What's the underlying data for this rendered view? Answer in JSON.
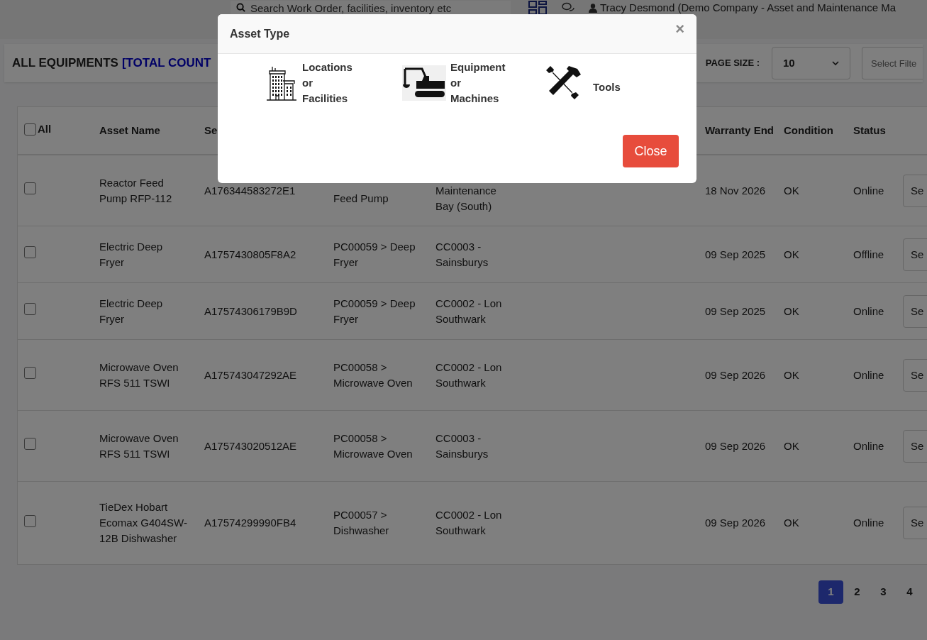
{
  "top_bar": {
    "search": {
      "placeholder": "Search Work Order, facilities, inventory etc"
    },
    "user": "Tracy Desmond (Demo Company - Asset and Maintenance Ma"
  },
  "header": {
    "title": "ALL EQUIPMENTS",
    "count_label": "[TOTAL COUNT",
    "page_size_label": "PAGE SIZE :",
    "page_size": "10",
    "filter": {
      "placeholder": "Select Filte"
    }
  },
  "table": {
    "columns": [
      {
        "label": "All",
        "checked": false
      },
      {
        "label": "Asset Name"
      },
      {
        "label": "Se"
      },
      {},
      {},
      {},
      {
        "label": "Warranty End"
      },
      {
        "label": "Condition"
      },
      {
        "label": "Status"
      }
    ],
    "rows": [
      {
        "checked": false,
        "asset_name": "Reactor Feed Pump RFP-112",
        "serial": "A176344583272E1",
        "column_3": "Feed Pump",
        "column_4": "Maintenance Bay (South)",
        "warranty_end": "18 Nov 2026",
        "condition": "OK",
        "status": "Online",
        "action": "Se"
      },
      {
        "checked": false,
        "asset_name": "Electric Deep Fryer",
        "serial": "A1757430805F8A2",
        "column_3": "PC00059 > Deep Fryer",
        "column_4": "CC0003 - Sainsburys",
        "warranty_end": "09 Sep 2025",
        "condition": "OK",
        "status": "Offline",
        "action": "Se"
      },
      {
        "checked": false,
        "asset_name": "Electric Deep Fryer",
        "serial": "A17574306179B9D",
        "column_3": "PC00059 > Deep Fryer",
        "column_4": "CC0002 - Lon Southwark",
        "warranty_end": "09 Sep 2025",
        "condition": "OK",
        "status": "Online",
        "action": "Se"
      },
      {
        "checked": false,
        "asset_name": "Microwave Oven RFS 511 TSWI",
        "serial": "A175743047292AE",
        "column_3": "PC00058 > Microwave Oven",
        "column_4": "CC0002 - Lon Southwark",
        "warranty_end": "09 Sep 2026",
        "condition": "OK",
        "status": "Online",
        "action": "Se"
      },
      {
        "checked": false,
        "asset_name": "Microwave Oven RFS 511 TSWI",
        "serial": "A175743020512AE",
        "column_3": "PC00058 > Microwave Oven",
        "column_4": "CC0003 - Sainsburys",
        "warranty_end": "09 Sep 2026",
        "condition": "OK",
        "status": "Online",
        "action": "Se"
      },
      {
        "checked": false,
        "asset_name": "TieDex Hobart Ecomax G404SW-12B Dishwasher",
        "serial": "A17574299990FB4",
        "column_3": "PC00057 > Dishwasher",
        "column_4": "CC0002 - Lon Southwark",
        "warranty_end": "09 Sep 2026",
        "condition": "OK",
        "status": "Online",
        "action": "Se"
      }
    ]
  },
  "pagination": [
    {
      "label": "1",
      "selected": true
    },
    {
      "label": "2",
      "selected": false
    },
    {
      "label": "3",
      "selected": false
    },
    {
      "label": "4",
      "selected": false
    }
  ],
  "modal": {
    "title": "Asset Type",
    "close_symbol": "×",
    "options": [
      {
        "kind": "building",
        "label": "Locations or Facilities"
      },
      {
        "kind": "excavator",
        "label": "Equipment or Machines"
      },
      {
        "kind": "tools",
        "label": "Tools"
      }
    ],
    "close_button": "Close"
  }
}
